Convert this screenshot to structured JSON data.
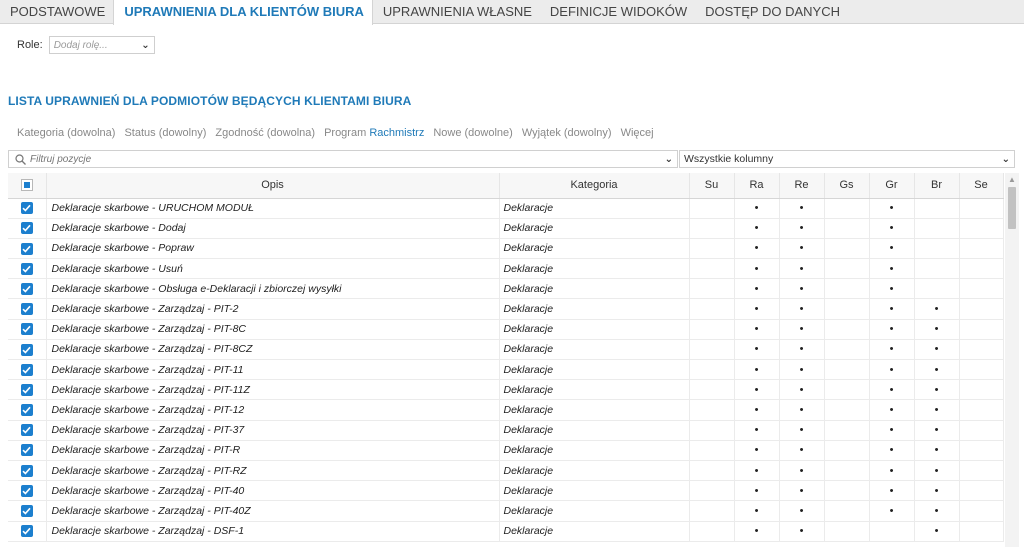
{
  "tabs": [
    {
      "label": "PODSTAWOWE",
      "active": false
    },
    {
      "label": "UPRAWNIENIA DLA KLIENTÓW BIURA",
      "active": true
    },
    {
      "label": "UPRAWNIENIA WŁASNE",
      "active": false
    },
    {
      "label": "DEFINICJE WIDOKÓW",
      "active": false
    },
    {
      "label": "DOSTĘP DO DANYCH",
      "active": false
    }
  ],
  "role": {
    "label": "Role:",
    "placeholder": "Dodaj rolę..."
  },
  "section_title": "LISTA UPRAWNIEŃ DLA PODMIOTÓW BĘDĄCYCH KLIENTAMI BIURA",
  "filters": {
    "kategoria": "Kategoria (dowolna)",
    "status": "Status (dowolny)",
    "zgodnosc": "Zgodność (dowolna)",
    "program_label": "Program",
    "program_value": "Rachmistrz",
    "nowe": "Nowe (dowolne)",
    "wyjatek": "Wyjątek (dowolny)",
    "wiecej": "Więcej"
  },
  "search": {
    "placeholder": "Filtruj pozycje"
  },
  "columns_select": {
    "value": "Wszystkie kolumny"
  },
  "table": {
    "headers": {
      "opis": "Opis",
      "kategoria": "Kategoria",
      "su": "Su",
      "ra": "Ra",
      "re": "Re",
      "gs": "Gs",
      "gr": "Gr",
      "br": "Br",
      "se": "Se"
    },
    "dot_symbol": "•",
    "rows": [
      {
        "opis": "Deklaracje skarbowe - URUCHOM MODUŁ",
        "kategoria": "Deklaracje",
        "checked": true,
        "su": false,
        "ra": true,
        "re": true,
        "gs": false,
        "gr": true,
        "br": false,
        "se": false
      },
      {
        "opis": "Deklaracje skarbowe - Dodaj",
        "kategoria": "Deklaracje",
        "checked": true,
        "su": false,
        "ra": true,
        "re": true,
        "gs": false,
        "gr": true,
        "br": false,
        "se": false
      },
      {
        "opis": "Deklaracje skarbowe - Popraw",
        "kategoria": "Deklaracje",
        "checked": true,
        "su": false,
        "ra": true,
        "re": true,
        "gs": false,
        "gr": true,
        "br": false,
        "se": false
      },
      {
        "opis": "Deklaracje skarbowe - Usuń",
        "kategoria": "Deklaracje",
        "checked": true,
        "su": false,
        "ra": true,
        "re": true,
        "gs": false,
        "gr": true,
        "br": false,
        "se": false
      },
      {
        "opis": "Deklaracje skarbowe - Obsługa e-Deklaracji i zbiorczej wysyłki",
        "kategoria": "Deklaracje",
        "checked": true,
        "su": false,
        "ra": true,
        "re": true,
        "gs": false,
        "gr": true,
        "br": false,
        "se": false
      },
      {
        "opis": "Deklaracje skarbowe - Zarządzaj - PIT-2",
        "kategoria": "Deklaracje",
        "checked": true,
        "su": false,
        "ra": true,
        "re": true,
        "gs": false,
        "gr": true,
        "br": true,
        "se": false
      },
      {
        "opis": "Deklaracje skarbowe - Zarządzaj - PIT-8C",
        "kategoria": "Deklaracje",
        "checked": true,
        "su": false,
        "ra": true,
        "re": true,
        "gs": false,
        "gr": true,
        "br": true,
        "se": false
      },
      {
        "opis": "Deklaracje skarbowe - Zarządzaj - PIT-8CZ",
        "kategoria": "Deklaracje",
        "checked": true,
        "su": false,
        "ra": true,
        "re": true,
        "gs": false,
        "gr": true,
        "br": true,
        "se": false
      },
      {
        "opis": "Deklaracje skarbowe - Zarządzaj - PIT-11",
        "kategoria": "Deklaracje",
        "checked": true,
        "su": false,
        "ra": true,
        "re": true,
        "gs": false,
        "gr": true,
        "br": true,
        "se": false
      },
      {
        "opis": "Deklaracje skarbowe - Zarządzaj - PIT-11Z",
        "kategoria": "Deklaracje",
        "checked": true,
        "su": false,
        "ra": true,
        "re": true,
        "gs": false,
        "gr": true,
        "br": true,
        "se": false
      },
      {
        "opis": "Deklaracje skarbowe - Zarządzaj - PIT-12",
        "kategoria": "Deklaracje",
        "checked": true,
        "su": false,
        "ra": true,
        "re": true,
        "gs": false,
        "gr": true,
        "br": true,
        "se": false
      },
      {
        "opis": "Deklaracje skarbowe - Zarządzaj - PIT-37",
        "kategoria": "Deklaracje",
        "checked": true,
        "su": false,
        "ra": true,
        "re": true,
        "gs": false,
        "gr": true,
        "br": true,
        "se": false
      },
      {
        "opis": "Deklaracje skarbowe - Zarządzaj - PIT-R",
        "kategoria": "Deklaracje",
        "checked": true,
        "su": false,
        "ra": true,
        "re": true,
        "gs": false,
        "gr": true,
        "br": true,
        "se": false
      },
      {
        "opis": "Deklaracje skarbowe - Zarządzaj - PIT-RZ",
        "kategoria": "Deklaracje",
        "checked": true,
        "su": false,
        "ra": true,
        "re": true,
        "gs": false,
        "gr": true,
        "br": true,
        "se": false
      },
      {
        "opis": "Deklaracje skarbowe - Zarządzaj - PIT-40",
        "kategoria": "Deklaracje",
        "checked": true,
        "su": false,
        "ra": true,
        "re": true,
        "gs": false,
        "gr": true,
        "br": true,
        "se": false
      },
      {
        "opis": "Deklaracje skarbowe - Zarządzaj - PIT-40Z",
        "kategoria": "Deklaracje",
        "checked": true,
        "su": false,
        "ra": true,
        "re": true,
        "gs": false,
        "gr": true,
        "br": true,
        "se": false
      },
      {
        "opis": "Deklaracje skarbowe - Zarządzaj - DSF-1",
        "kategoria": "Deklaracje",
        "checked": true,
        "su": false,
        "ra": true,
        "re": true,
        "gs": false,
        "gr": false,
        "br": true,
        "se": false
      }
    ]
  },
  "colors": {
    "accent": "#1f7ab8",
    "checkbox": "#1c7fce",
    "tab_bar": "#ececec"
  }
}
